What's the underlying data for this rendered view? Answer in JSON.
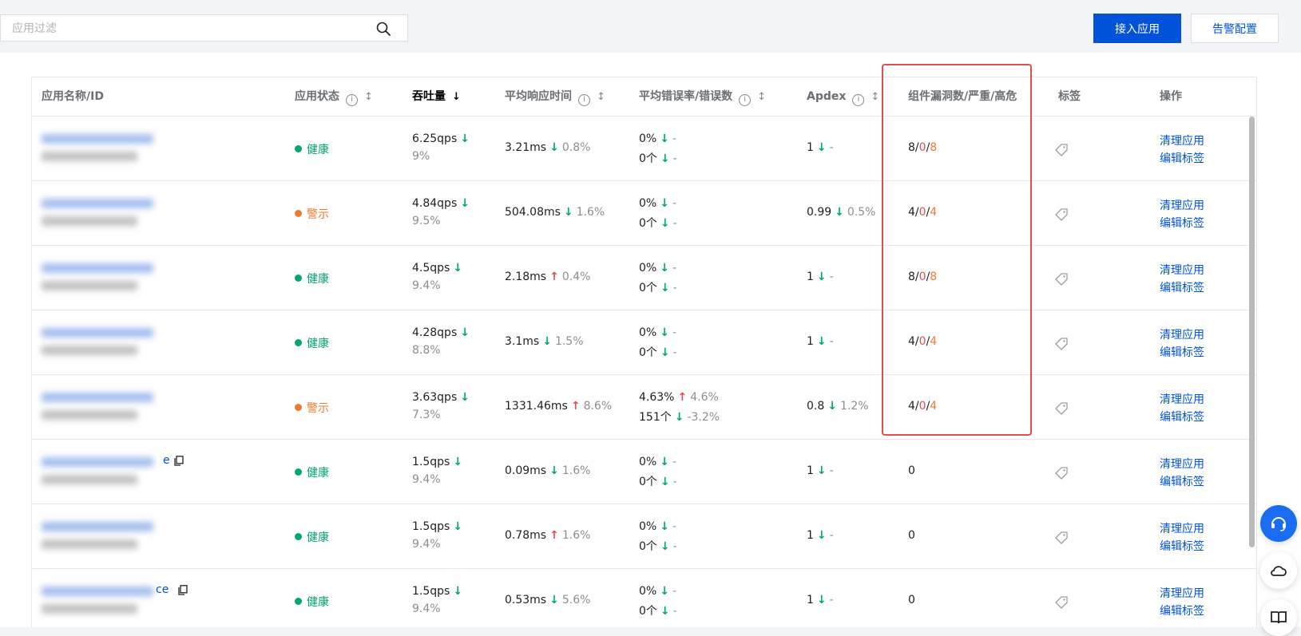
{
  "search": {
    "placeholder": "应用过滤"
  },
  "actions": {
    "connect_app": "接入应用",
    "alarm_config": "告警配置"
  },
  "columns": {
    "name": "应用名称/ID",
    "status": "应用状态",
    "throughput": "吞吐量",
    "avg_response": "平均响应时间",
    "error_rate": "平均错误率/错误数",
    "apdex": "Apdex",
    "vuln": "组件漏洞数/严重/高危",
    "tags": "标签",
    "ops": "操作"
  },
  "sort_glyphs": {
    "sortable": "↕",
    "desc": "↓"
  },
  "trend": {
    "down": "↓",
    "up": "↑"
  },
  "ops_labels": {
    "clean": "清理应用",
    "edit_tags": "编辑标签"
  },
  "status_colors": {
    "healthy": "#00a870",
    "warning": "#ed7b2f",
    "critical": "#e34d59",
    "link": "#0052d9"
  },
  "icons": [
    "search-icon",
    "info-icon",
    "sort-icon",
    "tag-icon",
    "copy-icon",
    "headset-icon",
    "cloud-icon",
    "book-icon"
  ],
  "rows": [
    {
      "name_tail": "",
      "status": "健康",
      "status_type": "ok",
      "qps": "6.25qps",
      "qps_trend": "down",
      "qps_pct": "9%",
      "resp": "3.21ms",
      "resp_trend": "down",
      "resp_pct": "0.8%",
      "err_rate": "0%",
      "err_rate_trend": "down",
      "err_rate_pct": "-",
      "err_count": "0个",
      "err_count_trend": "down",
      "err_count_pct": "-",
      "apdex": "1",
      "apdex_trend": "down",
      "apdex_pct": "-",
      "vuln_total": "8",
      "vuln_critical": "0",
      "vuln_high": "8"
    },
    {
      "name_tail": "",
      "status": "警示",
      "status_type": "warn",
      "qps": "4.84qps",
      "qps_trend": "down",
      "qps_pct": "9.5%",
      "resp": "504.08ms",
      "resp_trend": "down",
      "resp_pct": "1.6%",
      "err_rate": "0%",
      "err_rate_trend": "down",
      "err_rate_pct": "-",
      "err_count": "0个",
      "err_count_trend": "down",
      "err_count_pct": "-",
      "apdex": "0.99",
      "apdex_trend": "down",
      "apdex_pct": "0.5%",
      "vuln_total": "4",
      "vuln_critical": "0",
      "vuln_high": "4"
    },
    {
      "name_tail": "",
      "status": "健康",
      "status_type": "ok",
      "qps": "4.5qps",
      "qps_trend": "down",
      "qps_pct": "9.4%",
      "resp": "2.18ms",
      "resp_trend": "up",
      "resp_pct": "0.4%",
      "err_rate": "0%",
      "err_rate_trend": "down",
      "err_rate_pct": "-",
      "err_count": "0个",
      "err_count_trend": "down",
      "err_count_pct": "-",
      "apdex": "1",
      "apdex_trend": "down",
      "apdex_pct": "-",
      "vuln_total": "8",
      "vuln_critical": "0",
      "vuln_high": "8"
    },
    {
      "name_tail": "",
      "status": "健康",
      "status_type": "ok",
      "qps": "4.28qps",
      "qps_trend": "down",
      "qps_pct": "8.8%",
      "resp": "3.1ms",
      "resp_trend": "down",
      "resp_pct": "1.5%",
      "err_rate": "0%",
      "err_rate_trend": "down",
      "err_rate_pct": "-",
      "err_count": "0个",
      "err_count_trend": "down",
      "err_count_pct": "-",
      "apdex": "1",
      "apdex_trend": "down",
      "apdex_pct": "-",
      "vuln_total": "4",
      "vuln_critical": "0",
      "vuln_high": "4"
    },
    {
      "name_tail": "",
      "status": "警示",
      "status_type": "warn",
      "qps": "3.63qps",
      "qps_trend": "down",
      "qps_pct": "7.3%",
      "resp": "1331.46ms",
      "resp_trend": "up",
      "resp_pct": "8.6%",
      "err_rate": "4.63%",
      "err_rate_trend": "up",
      "err_rate_pct": "4.6%",
      "err_count": "151个",
      "err_count_trend": "down",
      "err_count_pct": "-3.2%",
      "apdex": "0.8",
      "apdex_trend": "down",
      "apdex_pct": "1.2%",
      "vuln_total": "4",
      "vuln_critical": "0",
      "vuln_high": "4"
    },
    {
      "name_tail": "e",
      "status": "健康",
      "status_type": "ok",
      "qps": "1.5qps",
      "qps_trend": "down",
      "qps_pct": "9.4%",
      "resp": "0.09ms",
      "resp_trend": "down",
      "resp_pct": "1.6%",
      "err_rate": "0%",
      "err_rate_trend": "down",
      "err_rate_pct": "-",
      "err_count": "0个",
      "err_count_trend": "down",
      "err_count_pct": "-",
      "apdex": "1",
      "apdex_trend": "down",
      "apdex_pct": "-",
      "vuln_total": "0",
      "vuln_critical": "",
      "vuln_high": ""
    },
    {
      "name_tail": "",
      "status": "健康",
      "status_type": "ok",
      "qps": "1.5qps",
      "qps_trend": "down",
      "qps_pct": "9.4%",
      "resp": "0.78ms",
      "resp_trend": "up",
      "resp_pct": "1.6%",
      "err_rate": "0%",
      "err_rate_trend": "down",
      "err_rate_pct": "-",
      "err_count": "0个",
      "err_count_trend": "down",
      "err_count_pct": "-",
      "apdex": "1",
      "apdex_trend": "down",
      "apdex_pct": "-",
      "vuln_total": "0",
      "vuln_critical": "",
      "vuln_high": ""
    },
    {
      "name_tail": "ce",
      "status": "健康",
      "status_type": "ok",
      "qps": "1.5qps",
      "qps_trend": "down",
      "qps_pct": "9.4%",
      "resp": "0.53ms",
      "resp_trend": "down",
      "resp_pct": "5.6%",
      "err_rate": "0%",
      "err_rate_trend": "down",
      "err_rate_pct": "-",
      "err_count": "0个",
      "err_count_trend": "down",
      "err_count_pct": "-",
      "apdex": "1",
      "apdex_trend": "down",
      "apdex_pct": "-",
      "vuln_total": "0",
      "vuln_critical": "",
      "vuln_high": ""
    }
  ]
}
